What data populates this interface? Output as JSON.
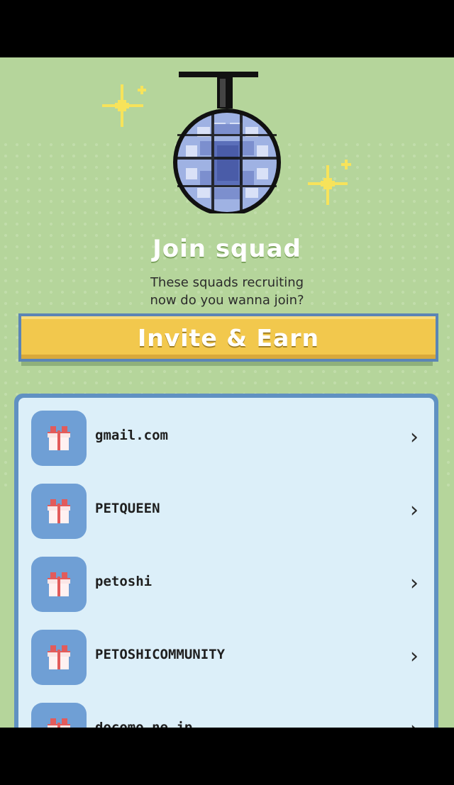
{
  "header": {
    "title": "Join squad",
    "subtitle_line1": "These squads recruiting",
    "subtitle_line2": "now do you wanna join?"
  },
  "invite_button": {
    "label": "Invite & Earn"
  },
  "squads": [
    {
      "name": "gmail.com",
      "icon": "gift-icon"
    },
    {
      "name": "PETQUEEN",
      "icon": "gift-icon"
    },
    {
      "name": "petoshi",
      "icon": "gift-icon"
    },
    {
      "name": "PETOSHICOMMUNITY",
      "icon": "gift-icon"
    },
    {
      "name": "docomo.ne.jp",
      "icon": "gift-icon"
    }
  ],
  "colors": {
    "background": "#b5d59b",
    "accent": "#f2c84d",
    "panel_border": "#6091c2",
    "panel_fill": "#dceff9",
    "icon_bg": "#6f9fd5"
  }
}
